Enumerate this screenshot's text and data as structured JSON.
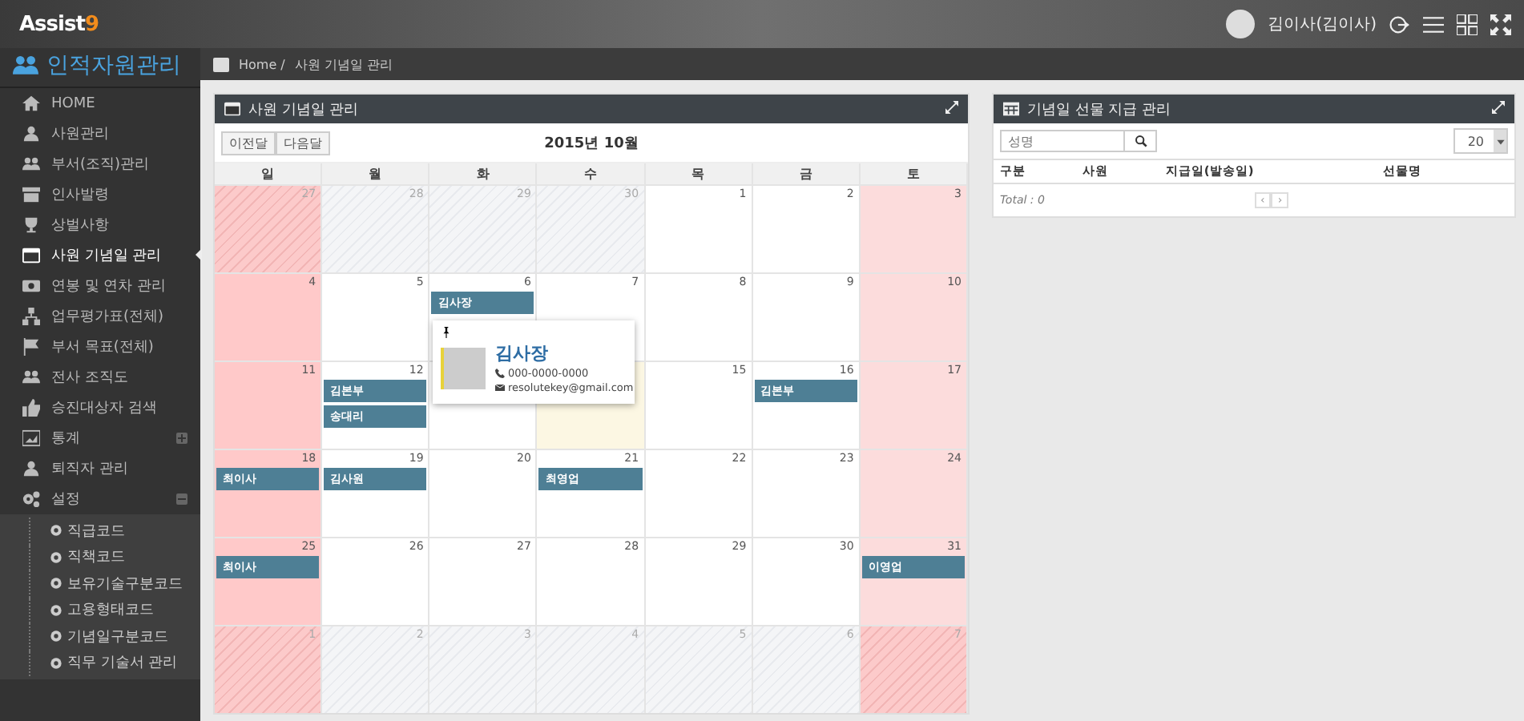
{
  "topbar": {
    "logo": "Assist",
    "logo_accent": "9",
    "user": "김이사(김이사)"
  },
  "sidebar": {
    "title": "인적자원관리",
    "items": [
      {
        "label": "HOME",
        "selected": false
      },
      {
        "label": "사원관리",
        "selected": false
      },
      {
        "label": "부서(조직)관리",
        "selected": false
      },
      {
        "label": "인사발령",
        "selected": false
      },
      {
        "label": "상벌사항",
        "selected": false
      },
      {
        "label": "사원 기념일 관리",
        "selected": true
      },
      {
        "label": "연봉 및 연차 관리",
        "selected": false
      },
      {
        "label": "업무평가표(전체)",
        "selected": false
      },
      {
        "label": "부서 목표(전체)",
        "selected": false
      },
      {
        "label": "전사 조직도",
        "selected": false
      },
      {
        "label": "승진대상자 검색",
        "selected": false
      },
      {
        "label": "통계",
        "selected": false,
        "expanded": false
      },
      {
        "label": "퇴직자 관리",
        "selected": false
      },
      {
        "label": "설정",
        "selected": false,
        "expanded": true,
        "children": [
          {
            "label": "직급코드",
            "selected": false
          },
          {
            "label": "직책코드",
            "selected": false
          },
          {
            "label": "보유기술구분코드",
            "selected": false
          },
          {
            "label": "고용형태코드",
            "selected": false
          },
          {
            "label": "기념일구분코드",
            "selected": false
          },
          {
            "label": "직무 기술서 관리",
            "selected": false
          }
        ]
      }
    ]
  },
  "breadcrumb": {
    "home": "Home /",
    "current": "사원 기념일 관리"
  },
  "calendar": {
    "title": "사원 기념일 관리",
    "prev": "이전달",
    "next": "다음달",
    "month": "2015년 10월",
    "weekdays": [
      {
        "label": "일",
        "holiday": true
      },
      {
        "label": "월",
        "holiday": false
      },
      {
        "label": "화",
        "holiday": false
      },
      {
        "label": "수",
        "holiday": false
      },
      {
        "label": "목",
        "holiday": false
      },
      {
        "label": "금",
        "holiday": false
      },
      {
        "label": "토",
        "holiday": true
      }
    ],
    "weeks": [
      [
        {
          "day": "27",
          "outside": true
        },
        {
          "day": "28",
          "outside": true
        },
        {
          "day": "29",
          "outside": true
        },
        {
          "day": "30",
          "outside": true
        },
        {
          "day": "1",
          "outside": false
        },
        {
          "day": "2",
          "outside": false
        },
        {
          "day": "3",
          "outside": false
        }
      ],
      [
        {
          "day": "4",
          "outside": false
        },
        {
          "day": "5",
          "outside": false
        },
        {
          "day": "6",
          "outside": false,
          "events": [
            "김사장"
          ]
        },
        {
          "day": "7",
          "outside": false
        },
        {
          "day": "8",
          "outside": false
        },
        {
          "day": "9",
          "outside": false
        },
        {
          "day": "10",
          "outside": false
        }
      ],
      [
        {
          "day": "11",
          "outside": false
        },
        {
          "day": "12",
          "outside": false,
          "events": [
            "김본부",
            "송대리"
          ]
        },
        {
          "outside": false
        },
        {
          "outside": false,
          "today": true
        },
        {
          "day": "15",
          "outside": false
        },
        {
          "day": "16",
          "outside": false,
          "events": [
            "김본부"
          ]
        },
        {
          "day": "17",
          "outside": false
        }
      ],
      [
        {
          "day": "18",
          "outside": false,
          "events": [
            "최이사"
          ]
        },
        {
          "day": "19",
          "outside": false,
          "events": [
            "김사원"
          ]
        },
        {
          "day": "20",
          "outside": false
        },
        {
          "day": "21",
          "outside": false,
          "events": [
            "최영업"
          ]
        },
        {
          "day": "22",
          "outside": false
        },
        {
          "day": "23",
          "outside": false
        },
        {
          "day": "24",
          "outside": false
        }
      ],
      [
        {
          "day": "25",
          "outside": false,
          "events": [
            "최이사"
          ]
        },
        {
          "day": "26",
          "outside": false
        },
        {
          "day": "27",
          "outside": false
        },
        {
          "day": "28",
          "outside": false
        },
        {
          "day": "29",
          "outside": false
        },
        {
          "day": "30",
          "outside": false
        },
        {
          "day": "31",
          "outside": false,
          "events": [
            "이영업"
          ]
        }
      ],
      [
        {
          "day": "1",
          "outside": true
        },
        {
          "day": "2",
          "outside": true
        },
        {
          "day": "3",
          "outside": true
        },
        {
          "day": "4",
          "outside": true
        },
        {
          "day": "5",
          "outside": true
        },
        {
          "day": "6",
          "outside": true
        },
        {
          "day": "7",
          "outside": true
        }
      ]
    ],
    "popup": {
      "name": "김사장",
      "phone": "000-0000-0000",
      "email": "resolutekey@gmail.com"
    }
  },
  "gifts": {
    "title": "기념일 선물 지급 관리",
    "search_placeholder": "성명",
    "page_size": "20",
    "columns": [
      "구분",
      "사원",
      "지급일(발송일)",
      "선물명"
    ],
    "total": "Total : 0",
    "prev": "‹",
    "next": "›"
  }
}
